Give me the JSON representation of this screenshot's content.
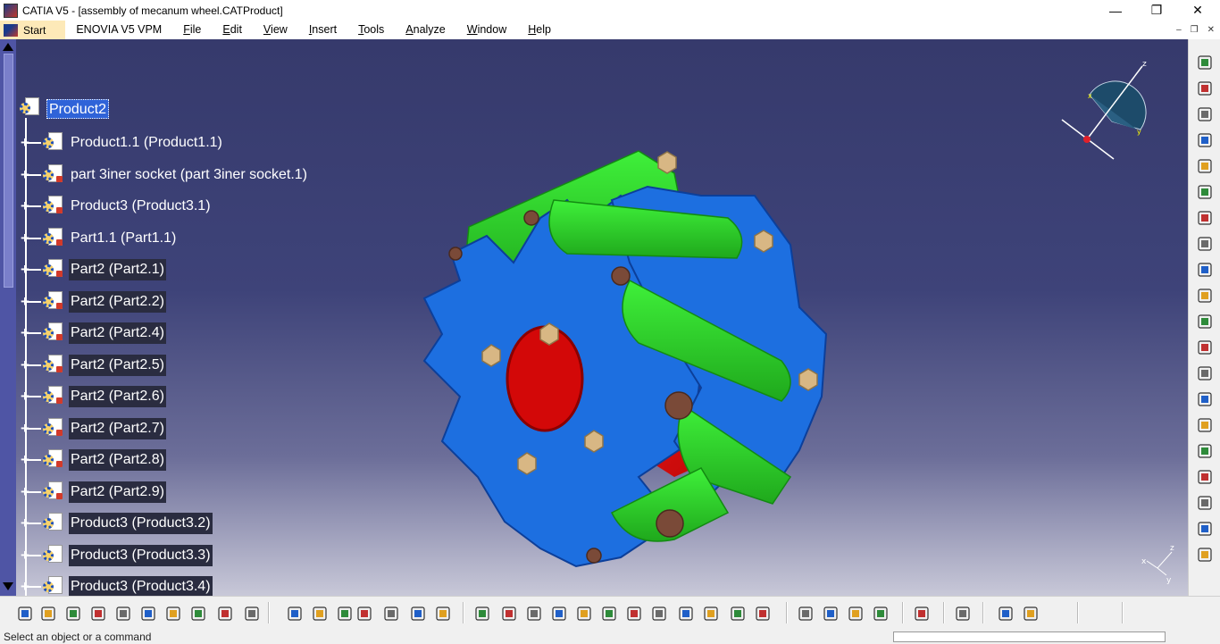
{
  "window": {
    "title": "CATIA V5 - [assembly of mecanum wheel.CATProduct]",
    "controls": {
      "minimize": "—",
      "restore": "❐",
      "close": "✕"
    }
  },
  "menubar": {
    "items": [
      "Start",
      "ENOVIA V5 VPM",
      "File",
      "Edit",
      "View",
      "Insert",
      "Tools",
      "Analyze",
      "Window",
      "Help"
    ],
    "mdi": {
      "minimize": "–",
      "restore": "❐",
      "close": "✕"
    }
  },
  "tree": {
    "root": "Product2",
    "nodes": [
      {
        "label": "Product1.1 (Product1.1)",
        "highlight": false
      },
      {
        "label": "part 3iner socket (part 3iner socket.1)",
        "highlight": false
      },
      {
        "label": "Product3 (Product3.1)",
        "highlight": false
      },
      {
        "label": "Part1.1 (Part1.1)",
        "highlight": false
      },
      {
        "label": "Part2 (Part2.1)",
        "highlight": true
      },
      {
        "label": "Part2 (Part2.2)",
        "highlight": true
      },
      {
        "label": "Part2 (Part2.4)",
        "highlight": true
      },
      {
        "label": "Part2 (Part2.5)",
        "highlight": true
      },
      {
        "label": "Part2 (Part2.6)",
        "highlight": true
      },
      {
        "label": "Part2 (Part2.7)",
        "highlight": true
      },
      {
        "label": "Part2 (Part2.8)",
        "highlight": true
      },
      {
        "label": "Part2 (Part2.9)",
        "highlight": true
      },
      {
        "label": "Product3 (Product3.2)",
        "highlight": true
      },
      {
        "label": "Product3 (Product3.3)",
        "highlight": true
      },
      {
        "label": "Product3 (Product3.4)",
        "highlight": true
      }
    ]
  },
  "compass": {
    "axis_x": "x",
    "axis_y": "y",
    "axis_z": "z"
  },
  "axis_triad": {
    "x": "x",
    "y": "y",
    "z": "z"
  },
  "toolbar_bottom": {
    "icons": [
      "new-icon",
      "open-icon",
      "save-icon",
      "print-icon",
      "cut-icon",
      "copy-icon",
      "paste-icon",
      "undo-icon",
      "redo-icon",
      "whats-this-icon",
      "formula-icon",
      "comment-icon",
      "hand-icon",
      "table-icon",
      "tree-expand-icon",
      "catalog-icon",
      "parameters-icon",
      "fly-mode-icon",
      "fit-all-icon",
      "pan-icon",
      "rotate-icon",
      "zoom-in-icon",
      "zoom-out-icon",
      "normal-view-icon",
      "multi-view-icon",
      "iso-view-icon",
      "shading-icon",
      "hide-show-icon",
      "swap-visible-icon",
      "camera-icon",
      "snapshot-icon",
      "measure-icon",
      "inertia-icon",
      "bolt-icon",
      "update-icon",
      "sketch-icon",
      "catia-logo-icon"
    ]
  },
  "toolbar_right": {
    "icons": [
      "gears-icon",
      "constraint-icon",
      "constraint2-icon",
      "constraint3-icon",
      "constraint4-icon",
      "select-icon",
      "existing-component-icon",
      "new-product-icon",
      "new-part-icon",
      "new-component-icon",
      "replace-icon",
      "graph-tree-icon",
      "reorder-icon",
      "numbering-icon",
      "multi-instantiation-icon",
      "explode-icon",
      "fast-multi-icon",
      "publish-icon",
      "bom-icon",
      "scene-icon"
    ]
  },
  "status": {
    "text": "Select an object or a command"
  },
  "colors": {
    "viewport_top": "#363a6c",
    "viewport_bottom": "#c8c8d8",
    "selection": "#2f63d8",
    "hub_blue": "#1d6fe0",
    "roller_green": "#2fd32b",
    "core_red": "#e01010"
  }
}
